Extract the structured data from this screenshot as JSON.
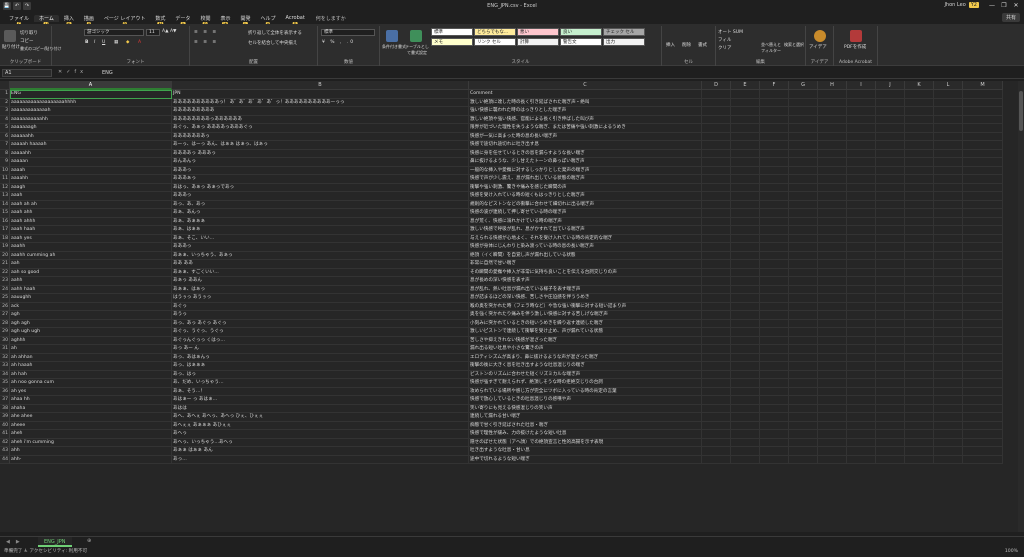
{
  "window": {
    "title": "ENG_JPN.csv  -  Excel",
    "user": "Jhon Leo",
    "user_badge": "Y2",
    "qat": [
      "💾",
      "↶",
      "↷"
    ],
    "controls": [
      "—",
      "❐",
      "✕"
    ]
  },
  "tabs": [
    {
      "label": "ファイル",
      "key": "F"
    },
    {
      "label": "ホーム",
      "key": "H",
      "active": true
    },
    {
      "label": "挿入",
      "key": "N"
    },
    {
      "label": "描画",
      "key": "JI"
    },
    {
      "label": "ページ レイアウト",
      "key": "P"
    },
    {
      "label": "数式",
      "key": "M"
    },
    {
      "label": "データ",
      "key": "A"
    },
    {
      "label": "校閲",
      "key": "R"
    },
    {
      "label": "表示",
      "key": "W"
    },
    {
      "label": "開発",
      "key": "L"
    },
    {
      "label": "ヘルプ",
      "key": "Y"
    },
    {
      "label": "Acrobat",
      "key": "B"
    }
  ],
  "tell_me": "何をしますか",
  "share_label": "共有",
  "ribbon": {
    "clipboard": {
      "paste": "貼り付け",
      "cut": "切り取り",
      "copy": "コピー",
      "format_painter": "書式のコピー/貼り付け",
      "label": "クリップボード"
    },
    "font": {
      "name": "游ゴシック",
      "size": "11",
      "label": "フォント"
    },
    "alignment": {
      "wrap": "折り返して全体を表示する",
      "merge": "セルを結合して中央揃え",
      "label": "配置"
    },
    "number": {
      "format": "標準",
      "label": "数値"
    },
    "styles_group": {
      "conditional": "条件付き書式",
      "table": "テーブルとして書式設定",
      "label": "スタイル"
    },
    "styles": [
      {
        "name": "標準",
        "bg": "#ffffff"
      },
      {
        "name": "どちらでもな...",
        "bg": "#ffeb9c"
      },
      {
        "name": "悪い",
        "bg": "#ffc7ce"
      },
      {
        "name": "良い",
        "bg": "#c6efce"
      },
      {
        "name": "チェック セル",
        "bg": "#a5a5a5"
      },
      {
        "name": "メモ",
        "bg": "#ffffcc"
      },
      {
        "name": "リンク セル",
        "bg": "#ffffff"
      },
      {
        "name": "計算",
        "bg": "#f2f2f2"
      },
      {
        "name": "警告文",
        "bg": "#ffffff"
      },
      {
        "name": "出力",
        "bg": "#f2f2f2"
      }
    ],
    "cells": {
      "insert": "挿入",
      "delete": "削除",
      "format": "書式",
      "label": "セル"
    },
    "editing": {
      "autosum": "オート SUM",
      "fill": "フィル",
      "clear": "クリア",
      "sort": "並べ替えとフィルター",
      "find": "検索と選択",
      "label": "編集"
    },
    "ideas": {
      "btn": "アイデア",
      "label": "アイデア"
    },
    "acrobat": {
      "btn": "PDFを作成",
      "label": "Adobe Acrobat"
    }
  },
  "formula_bar": {
    "name_box": "A1",
    "fx": "fx",
    "value": "ENG"
  },
  "columns": [
    "A",
    "B",
    "C",
    "D",
    "E",
    "F",
    "G",
    "H",
    "I",
    "J",
    "K",
    "L",
    "M"
  ],
  "rows": [
    [
      "ENG",
      "JPN",
      "Comment"
    ],
    [
      "aaaaaaaaaaaaaaaaaaahhhh",
      "ああああああああああっ！ あ゛あ゛あ゛あ゛あ゛っ！ああああああああああーっっ",
      "激しい絶頂に達した時の長く引き延ばされた喘ぎ声・絶叫"
    ],
    [
      "aaaaaaaaaaaaah",
      "あああああああああ",
      "強い快感に襲われた時のはっきりとした喘ぎ声"
    ],
    [
      "aaaaaaaaaaahh",
      "ああああああああっああああああ",
      "激しい絶頂や強い快感、官能による長く引き伸ばした叫び声"
    ],
    [
      "aaaaaaagh",
      "あぐっ、あぁっ ああああっあああぐっ",
      "限界が近づいた理性を失うような喘ぎ、または苦痛や強い刺激によるうめき"
    ],
    [
      "aaaaaahh",
      "あああああああっ",
      "快感が一気に高まった時の息の長い喘ぎ声"
    ],
    [
      "aaaaah haaaah",
      "あーっ、はーっ あん、はぁぁ はぁっ、はぁっ",
      "快感で途切れ途切れに吐き出す息"
    ],
    [
      "aaaaahh",
      "ああああっ あああっ",
      "快感に身を任せているときの息を漏らすような長い喘ぎ"
    ],
    [
      "aaaaan",
      "あんあんっ",
      "鼻に抜けるような、少し甘えたトーンの鼻っぽい喘ぎ声"
    ],
    [
      "aaaah",
      "あああっ",
      "一般的な挿入や愛撫に対するしっかりとした発声の喘ぎ声"
    ],
    [
      "aaaahh",
      "あああぁっ",
      "快感で声が少し震え、息が漏れ出している状態の喘ぎ声"
    ],
    [
      "aaagh",
      "あはっ、あぁっ あぁっであっ",
      "衝撃や強い刺激、驚きや痛みを感じた瞬間の声"
    ],
    [
      "aaah",
      "あああっ",
      "快感を受け入れている時の短くもはっきりとした喘ぎ声"
    ],
    [
      "aaah ah ah",
      "あっ、あ、あっ",
      "規則的なピストンなどの衝撃に合わせて細切れに出る喘ぎ声"
    ],
    [
      "aaah ahh",
      "あぁ、あんっ",
      "快感の波が連続して押し寄せている時の喘ぎ声"
    ],
    [
      "aaah ahhh",
      "あぁ、あぁぁぁ",
      "息が荒く、快感に溺れかけている時の喘ぎ声"
    ],
    [
      "aaah haah",
      "あぁ、はぁぁ",
      "激しい快感で呼吸が乱れ、息がかすれて出ている喘ぎ声"
    ],
    [
      "aaah yes",
      "あぁ、そこ、いい…",
      "与えられる快感が心地よく、それを受け入れている時の肯定的な喘ぎ"
    ],
    [
      "aaahh",
      "あああっ",
      "快感が身体にじんわりと染み渡っている時の息の長い喘ぎ声"
    ],
    [
      "aaahh cumming ah",
      "あぁぁ、いっちゃう、あぁっ",
      "絶頂（イく瞬間）を自覚し声が漏れ出している状態"
    ],
    [
      "aah",
      "ああ ああ",
      "非常に自然で甘い喘ぎ"
    ],
    [
      "aah so good",
      "あぁぁ、すごくいい…",
      "その瞬間の愛撫や挿入が非常に気持ち良いことを伝える台詞交じりの声"
    ],
    [
      "aahh",
      "あぁっ ああん",
      "息が長めの深い快感を表す声"
    ],
    [
      "aahh haah",
      "あぁぁ、はぁっ",
      "息が乱れ、熱い吐息が漏れ出ている様子を表す喘ぎ声"
    ],
    [
      "aauughh",
      "はうぅっ あうぅっ",
      "息が詰まるほどの深い快感、苦しさや圧迫感を伴ううめき"
    ],
    [
      "ack",
      "あぐっ",
      "喉の奥を突かれた時（フェラ時など）や急な強い衝撃に対する短い詰まり声"
    ],
    [
      "agh",
      "あうっ",
      "奥を強く突かれたり痛みを伴う激しい快感に対する苦しげな喘ぎ声"
    ],
    [
      "agh agh",
      "あっ、あっ あぐっ あぐっ",
      "小刻みに突かれているときの短いうめきを繰り返す連続した喘ぎ"
    ],
    [
      "agh ugh ugh",
      "あぐっ、うぐっ、うぐっ",
      "激しいピストンで連続して衝撃を受け止め、声が漏れている状態"
    ],
    [
      "aghhh",
      "あぐっんぐっっ くはっ…",
      "苦しさや抑えきれない快感が混ざった喘ぎ"
    ],
    [
      "ah",
      "あっ あー ん",
      "漏れ出る短い吐息や小さな驚きの声"
    ],
    [
      "ah ahhan",
      "あっ、あはぁんっ",
      "エロティシズムが高まり、鼻に抜けるような声が混ざった喘ぎ"
    ],
    [
      "ah haaah",
      "あっ、はぁぁぁ",
      "衝撃の後に大きく息を吐き出すような吐息混じりの喘ぎ"
    ],
    [
      "ah hah",
      "あっ、はっ",
      "ピストンのリズムに合わせた短くリズミカルな喘ぎ声"
    ],
    [
      "ah noo gonna cum",
      "あ、だめ、いっちゃう…",
      "快感が強すぎて耐えられず、絶頂しそうな時の拒絶交じりの台詞"
    ],
    [
      "ah yes",
      "あぁ、そう…！",
      "攻められている場所や感じ方が完全にツボに入っている時の肯定の言葉"
    ],
    [
      "ahaa hh",
      "あはぁー っ あはぁ…",
      "快感で放心しているときの吐息混じりの感嘆や声"
    ],
    [
      "ahaha",
      "あはは",
      "笑い寄りにも見える快感混じりの笑い声"
    ],
    [
      "ahe ahee",
      "あへ、あへぇ あへっ、あへっ ひぇ、ひぇぇ",
      "連続して漏れる甘い喘ぎ"
    ],
    [
      "aheee",
      "あへぇぇ あぁぁぁ あひぇぇ",
      "痴態で甘く引き延ばされた吐息・喘ぎ"
    ],
    [
      "aheh",
      "あへっ",
      "快感で理性が緩み、力の抜けたような短い吐息"
    ],
    [
      "aheh i'm cumming",
      "あへっ、いっちゃう…あへっ",
      "隠せのぼせた状態（アへ顔）での絶頂宣言と性的高揚を示す表現"
    ],
    [
      "ahh",
      "あぁぁ はぁぁ あん",
      "吐き出すような吐息・甘い息"
    ],
    [
      "ahh-",
      "あっ…",
      "途中で切れるような短い喘ぎ"
    ]
  ],
  "sheet_tab": "ENG_JPN",
  "status": {
    "left": "準備完了   ♿ アクセシビリティ: 利用不可",
    "zoom": "100%"
  }
}
